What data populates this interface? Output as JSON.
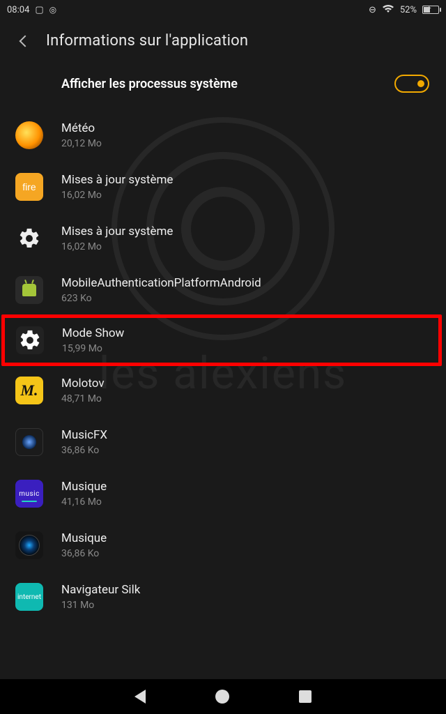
{
  "status": {
    "time": "08:04",
    "battery_pct": "52%"
  },
  "header": {
    "title": "Informations sur l'application"
  },
  "toggle": {
    "label": "Afficher les processus système",
    "on": true
  },
  "apps": [
    {
      "icon": "meteo",
      "name": "Météo",
      "size": "20,12 Mo",
      "highlight": false
    },
    {
      "icon": "fire",
      "name": "Mises à jour système",
      "size": "16,02 Mo",
      "highlight": false
    },
    {
      "icon": "gear",
      "name": "Mises à jour système",
      "size": "16,02 Mo",
      "highlight": false
    },
    {
      "icon": "android",
      "name": "MobileAuthenticationPlatformAndroid",
      "size": "623 Ko",
      "highlight": false
    },
    {
      "icon": "gear2",
      "name": "Mode Show",
      "size": "15,99 Mo",
      "highlight": true
    },
    {
      "icon": "molotov",
      "name": "Molotov",
      "size": "48,71 Mo",
      "highlight": false
    },
    {
      "icon": "musicfx",
      "name": "MusicFX",
      "size": "36,86 Ko",
      "highlight": false
    },
    {
      "icon": "music",
      "name": "Musique",
      "size": "41,16 Mo",
      "highlight": false
    },
    {
      "icon": "speaker",
      "name": "Musique",
      "size": "36,86 Ko",
      "highlight": false
    },
    {
      "icon": "silk",
      "name": "Navigateur Silk",
      "size": "131 Mo",
      "highlight": false
    }
  ],
  "watermark_text": "les alexiens"
}
